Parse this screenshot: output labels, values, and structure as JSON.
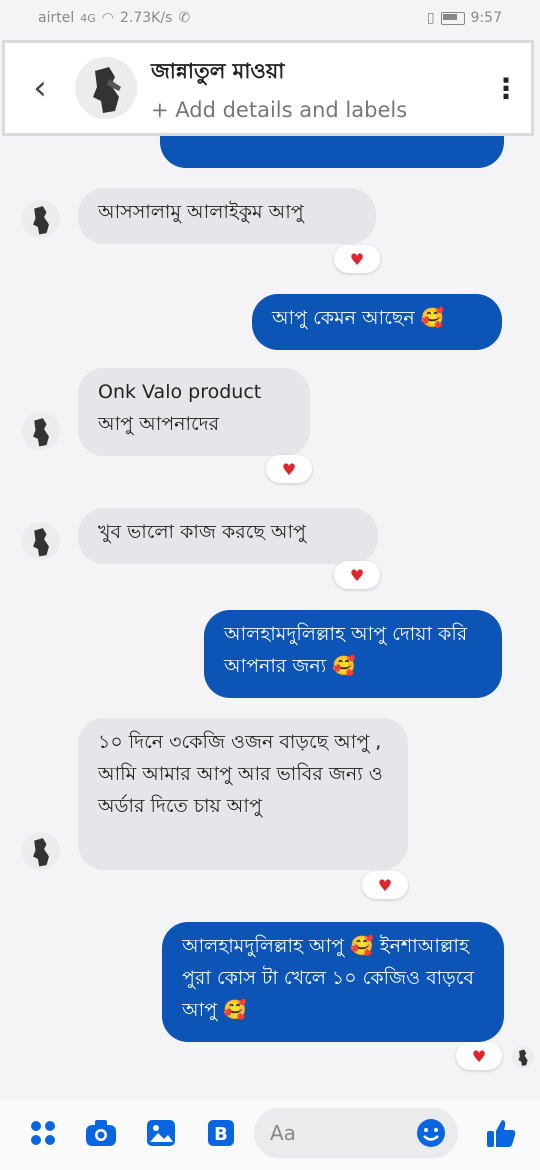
{
  "status": {
    "carrier": "airtel",
    "signal": "4G",
    "speed": "2.73K/s",
    "time": "9:57"
  },
  "header": {
    "name": "জান্নাতুল মাওয়া",
    "subtitle": "+ Add details and labels"
  },
  "messages": [
    {
      "dir": "in",
      "text": "আসসালামু আলাইকুম আপু",
      "reaction": "♥"
    },
    {
      "dir": "out",
      "text": "আপু কেমন আছেন 🥰"
    },
    {
      "dir": "in",
      "text": "Onk Valo product আপু আপনাদের",
      "reaction": "♥"
    },
    {
      "dir": "in",
      "text": "খুব ভালো কাজ করছে আপু",
      "reaction": "♥"
    },
    {
      "dir": "out",
      "text": "আলহামদুলিল্লাহ আপু দোয়া করি আপনার জন্য 🥰"
    },
    {
      "dir": "in",
      "text": "১০ দিনে ৩কেজি ওজন বাড়ছে আপু , আমি আমার আপু আর ভাবির জন্য ও অর্ডার দিতে চায় আপু",
      "reaction": "♥"
    },
    {
      "dir": "out",
      "text": "আলহামদুলিল্লাহ আপু 🥰 ইনশাআল্লাহ পুরা কোস টা খেলে ১০ কেজিও বাড়বে আপু 🥰",
      "reaction": "♥"
    }
  ],
  "composer": {
    "placeholder": "Aa",
    "icons": [
      "menu-dots-icon",
      "camera-icon",
      "gallery-icon",
      "sticker-icon",
      "emoji-icon",
      "like-icon"
    ]
  },
  "colors": {
    "outgoing": "#0c54b6",
    "incoming": "#e6e6ea",
    "accent": "#0a66e0",
    "reaction": "#e0242e"
  }
}
